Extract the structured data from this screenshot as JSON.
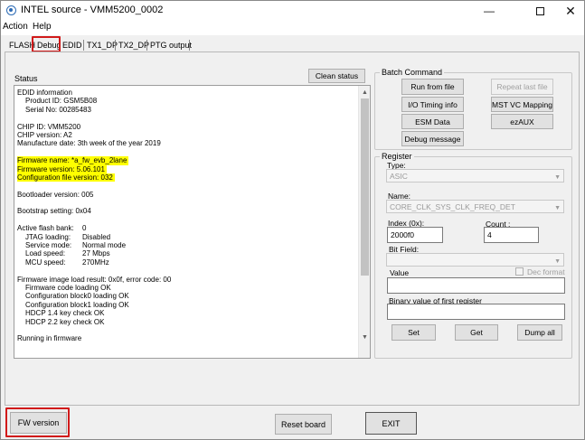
{
  "window": {
    "title": "INTEL source - VMM5200_0002"
  },
  "menu": {
    "items": [
      "Action",
      "Help"
    ]
  },
  "tabs": [
    {
      "label": "FLASH"
    },
    {
      "label": "Debug"
    },
    {
      "label": "EDID"
    },
    {
      "label": "TX1_DP"
    },
    {
      "label": "TX2_DP"
    },
    {
      "label": "PTG output"
    }
  ],
  "status": {
    "label": "Status",
    "clean_button": "Clean status",
    "log": [
      "EDID information",
      "Product ID: GSM5B08",
      "Serial No: 00285483",
      "CHIP ID: VMM5200",
      "CHIP version: A2",
      "Manufacture date: 3th week of the year 2019",
      "Firmware name: *a_fw_evb_2lane",
      "Firmware version: 5.06.101",
      "Configuration file version: 032",
      "Bootloader version: 005",
      "Bootstrap setting: 0x04",
      "Active flash bank:",
      "0",
      "JTAG loading:",
      "Disabled",
      "Service mode:",
      "Normal mode",
      "Load speed:",
      "27 Mbps",
      "MCU speed:",
      "270MHz",
      "Firmware image load result: 0x0f, error code: 00",
      "Firmware code loading OK",
      "Configuration block0 loading OK",
      "Configuration block1 loading OK",
      "HDCP 1.4 key check OK",
      "HDCP 2.2 key check OK",
      "Running in firmware"
    ]
  },
  "batch": {
    "title": "Batch Command",
    "run_from_file": "Run from file",
    "repeat_last_file": "Repeat last file",
    "io_timing": "I/O Timing info",
    "mst_vc": "MST VC Mapping",
    "esm_data": "ESM Data",
    "ezaux": "ezAUX",
    "debug_message": "Debug message"
  },
  "register": {
    "title": "Register",
    "type_label": "Type:",
    "type_value": "ASIC",
    "name_label": "Name:",
    "name_value": "CORE_CLK_SYS_CLK_FREQ_DET",
    "index_label": "Index (0x):",
    "index_value": "2000f0",
    "count_label": "Count :",
    "count_value": "4",
    "bitfield_label": "Bit Field:",
    "value_label": "Value",
    "dec_format_label": "Dec format",
    "binary_label": "Binary value of first register",
    "set": "Set",
    "get": "Get",
    "dump_all": "Dump all"
  },
  "footer": {
    "fw_version": "FW version",
    "reset_board": "Reset board",
    "exit": "EXIT"
  },
  "colors": {
    "highlight": "#ffff00",
    "annotation": "#d11a1a",
    "accent": "#2d6bb5"
  }
}
